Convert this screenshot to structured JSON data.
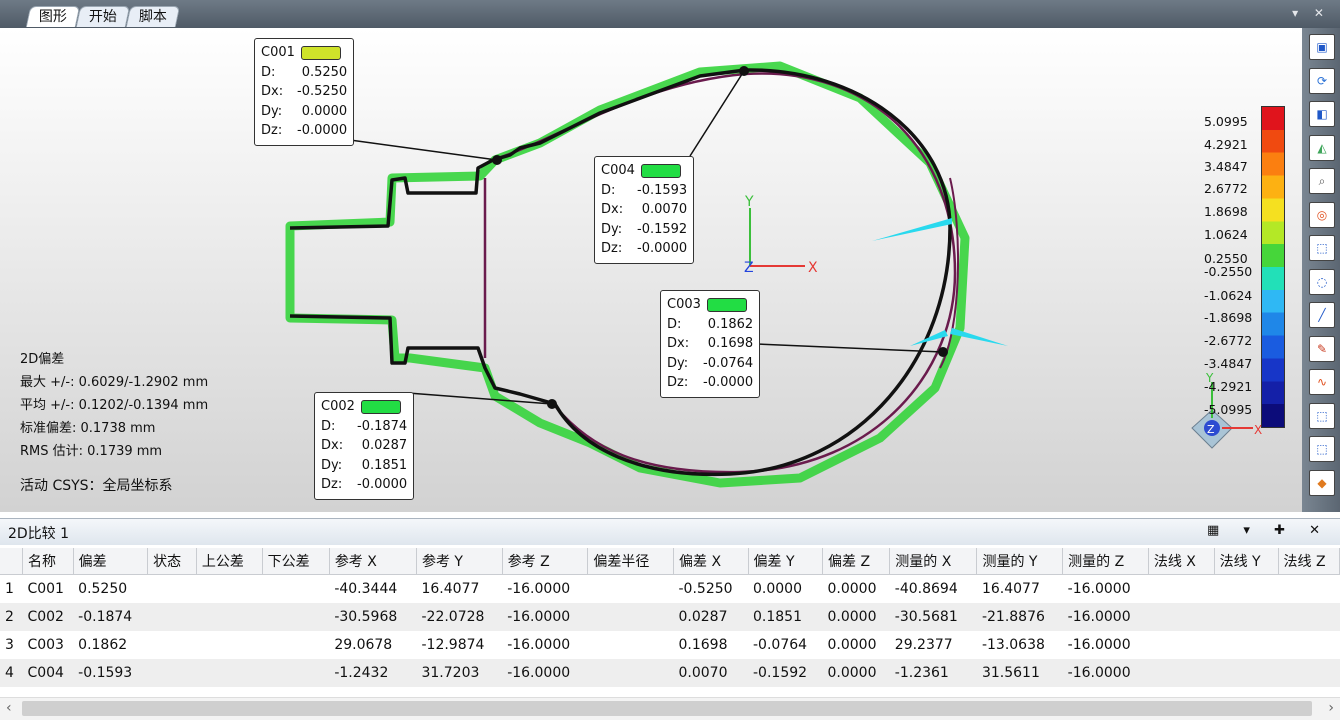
{
  "tabs": [
    {
      "label": "图形",
      "active": true
    },
    {
      "label": "开始",
      "active": false
    },
    {
      "label": "脚本",
      "active": false
    }
  ],
  "callouts": [
    {
      "name": "C001",
      "color": "#cfe32a",
      "rows": [
        {
          "k": "D:",
          "v": "0.5250"
        },
        {
          "k": "Dx:",
          "v": "-0.5250"
        },
        {
          "k": "Dy:",
          "v": "0.0000"
        },
        {
          "k": "Dz:",
          "v": "-0.0000"
        }
      ]
    },
    {
      "name": "C002",
      "color": "#22dd44",
      "rows": [
        {
          "k": "D:",
          "v": "-0.1874"
        },
        {
          "k": "Dx:",
          "v": "0.0287"
        },
        {
          "k": "Dy:",
          "v": "0.1851"
        },
        {
          "k": "Dz:",
          "v": "-0.0000"
        }
      ]
    },
    {
      "name": "C003",
      "color": "#22dd44",
      "rows": [
        {
          "k": "D:",
          "v": "0.1862"
        },
        {
          "k": "Dx:",
          "v": "0.1698"
        },
        {
          "k": "Dy:",
          "v": "-0.0764"
        },
        {
          "k": "Dz:",
          "v": "-0.0000"
        }
      ]
    },
    {
      "name": "C004",
      "color": "#22dd44",
      "rows": [
        {
          "k": "D:",
          "v": "-0.1593"
        },
        {
          "k": "Dx:",
          "v": "0.0070"
        },
        {
          "k": "Dy:",
          "v": "-0.1592"
        },
        {
          "k": "Dz:",
          "v": "-0.0000"
        }
      ]
    }
  ],
  "stats": {
    "title": "2D偏差",
    "max": "最大 +/-: 0.6029/-1.2902 mm",
    "avg": "平均 +/-: 0.1202/-0.1394 mm",
    "std": "标准偏差: 0.1738 mm",
    "rms": "RMS 估计: 0.1739 mm",
    "csys": "活动 CSYS：全局坐标系"
  },
  "axes": {
    "x": "X",
    "y": "Y",
    "z": "Z"
  },
  "legend": {
    "values": [
      "5.0995",
      "4.2921",
      "3.4847",
      "2.6772",
      "1.8698",
      "1.0624",
      "0.2550",
      "-0.2550",
      "-1.0624",
      "-1.8698",
      "-2.6772",
      "-3.4847",
      "-4.2921",
      "-5.0995"
    ],
    "colors": [
      "#e0141c",
      "#f04a10",
      "#fb7f10",
      "#fdb112",
      "#f5e020",
      "#b4e826",
      "#46d63a",
      "#22e0b8",
      "#2fb8f4",
      "#1f87e8",
      "#1a5ce0",
      "#1736c8",
      "#1420a8",
      "#0c0c7a"
    ]
  },
  "tool_icons": [
    "view-cube-icon",
    "rotate-icon",
    "view-icon",
    "layers-icon",
    "zoom-icon",
    "target-icon",
    "select-rect-icon",
    "select-lasso-icon",
    "line-tool-icon",
    "brush-icon",
    "curve-icon",
    "select-front-icon",
    "select-through-icon",
    "shield-icon"
  ],
  "panel": {
    "title": "2D比较 1",
    "controls": "▦ ▾ ✚ ✕"
  },
  "table": {
    "headers": [
      "名称",
      "偏差",
      "状态",
      "上公差",
      "下公差",
      "参考 X",
      "参考 Y",
      "参考 Z",
      "偏差半径",
      "偏差 X",
      "偏差 Y",
      "偏差 Z",
      "测量的 X",
      "测量的 Y",
      "测量的 Z",
      "法线 X",
      "法线 Y",
      "法线 Z"
    ],
    "rows": [
      {
        "idx": "1",
        "cells": [
          "C001",
          "0.5250",
          "",
          "",
          "",
          "-40.3444",
          "16.4077",
          "-16.0000",
          "",
          "-0.5250",
          "0.0000",
          "0.0000",
          "-40.8694",
          "16.4077",
          "-16.0000",
          "",
          "",
          ""
        ]
      },
      {
        "idx": "2",
        "cells": [
          "C002",
          "-0.1874",
          "",
          "",
          "",
          "-30.5968",
          "-22.0728",
          "-16.0000",
          "",
          "0.0287",
          "0.1851",
          "0.0000",
          "-30.5681",
          "-21.8876",
          "-16.0000",
          "",
          "",
          ""
        ]
      },
      {
        "idx": "3",
        "cells": [
          "C003",
          "0.1862",
          "",
          "",
          "",
          "29.0678",
          "-12.9874",
          "-16.0000",
          "",
          "0.1698",
          "-0.0764",
          "0.0000",
          "29.2377",
          "-13.0638",
          "-16.0000",
          "",
          "",
          ""
        ]
      },
      {
        "idx": "4",
        "cells": [
          "C004",
          "-0.1593",
          "",
          "",
          "",
          "-1.2432",
          "31.7203",
          "-16.0000",
          "",
          "0.0070",
          "-0.1592",
          "0.0000",
          "-1.2361",
          "31.5611",
          "-16.0000",
          "",
          "",
          ""
        ]
      }
    ]
  }
}
